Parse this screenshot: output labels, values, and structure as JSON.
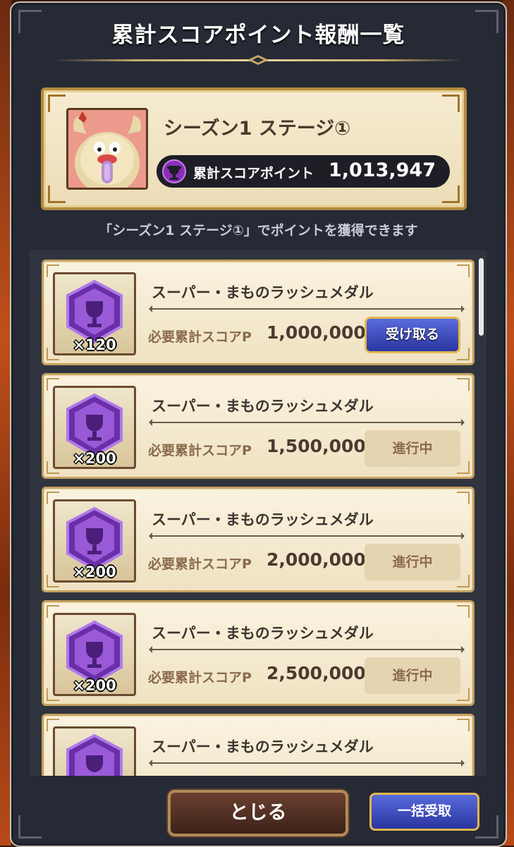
{
  "dialog": {
    "title": "累計スコアポイント報酬一覧"
  },
  "season": {
    "name": "シーズン1 ステージ①",
    "score_label": "累計スコアポイント",
    "score_value": "1,013,947",
    "hint": "「シーズン1 ステージ①」でポイントを獲得できます"
  },
  "rewards": [
    {
      "name": "スーパー・まものラッシュメダル",
      "count": "×120",
      "req_label": "必要累計スコアP",
      "req_value": "1,000,000",
      "action": "受け取る",
      "state": "claimable"
    },
    {
      "name": "スーパー・まものラッシュメダル",
      "count": "×200",
      "req_label": "必要累計スコアP",
      "req_value": "1,500,000",
      "action": "進行中",
      "state": "in_progress"
    },
    {
      "name": "スーパー・まものラッシュメダル",
      "count": "×200",
      "req_label": "必要累計スコアP",
      "req_value": "2,000,000",
      "action": "進行中",
      "state": "in_progress"
    },
    {
      "name": "スーパー・まものラッシュメダル",
      "count": "×200",
      "req_label": "必要累計スコアP",
      "req_value": "2,500,000",
      "action": "進行中",
      "state": "in_progress"
    },
    {
      "name": "スーパー・まものラッシュメダル",
      "count": "",
      "req_label": "",
      "req_value": "",
      "action": "",
      "state": "partial"
    }
  ],
  "buttons": {
    "close": "とじる",
    "bulk_claim": "一括受取"
  },
  "colors": {
    "accent_blue": "#2a35a0",
    "gold_border": "#e1b84e",
    "medal_purple": "#8a4fd0"
  }
}
